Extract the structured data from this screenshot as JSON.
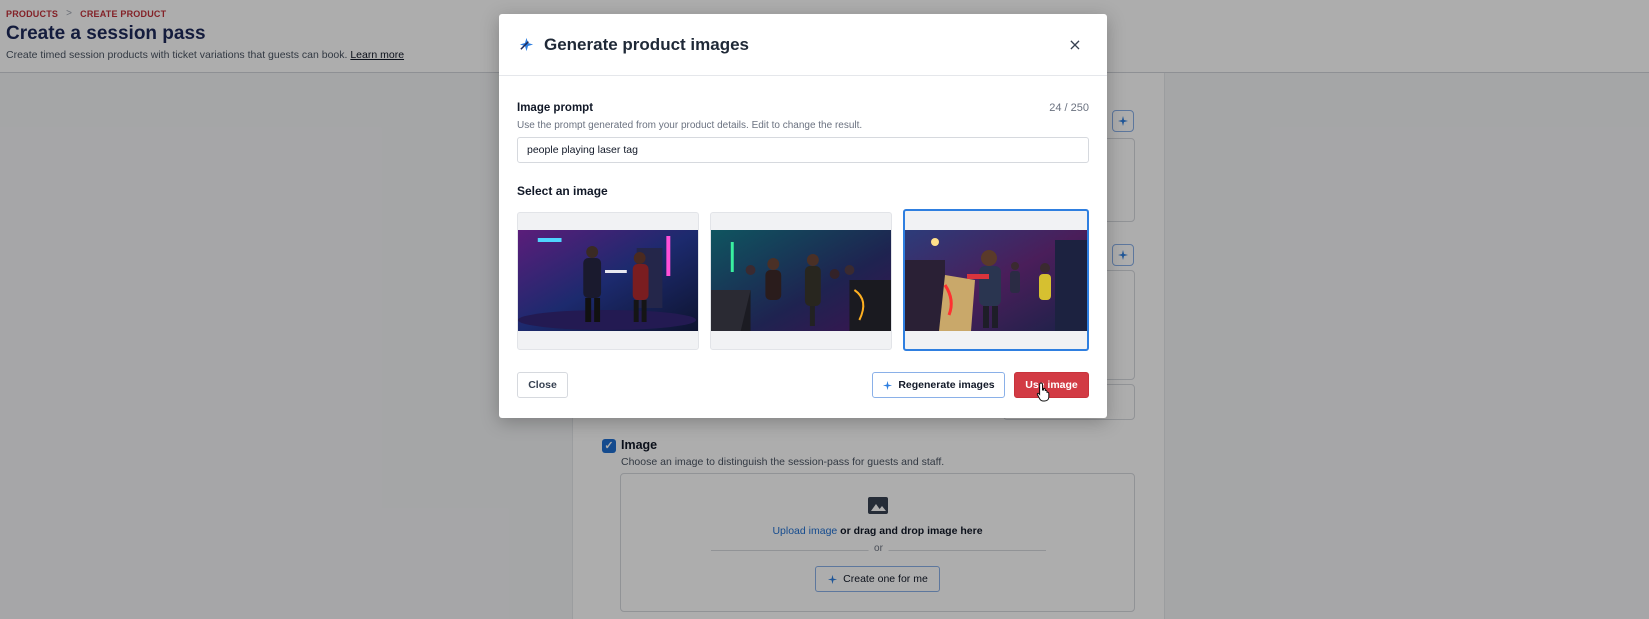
{
  "header": {
    "breadcrumb": [
      "PRODUCTS",
      "CREATE PRODUCT"
    ],
    "breadcrumb_separator": ">",
    "title": "Create a session pass",
    "subtitle": "Create timed session products with ticket variations that guests can book.",
    "learn_more": "Learn more"
  },
  "background_form": {
    "image_checkbox_checked": true,
    "image_label": "Image",
    "image_help": "Choose an image to distinguish the session-pass for guests and staff.",
    "upload_link": "Upload image",
    "upload_rest": " or drag and drop image here",
    "or_text": "or",
    "create_button": "Create one for me"
  },
  "modal": {
    "icon": "sparkle-ai-icon",
    "title": "Generate product images",
    "close_icon": "×",
    "prompt_label": "Image prompt",
    "prompt_count": "24 / 250",
    "prompt_help": "Use the prompt generated from your product details. Edit to change the result.",
    "prompt_value": "people playing laser tag",
    "select_label": "Select an image",
    "selected_index": 2,
    "close_button": "Close",
    "regenerate_button": "Regenerate images",
    "use_button": "Use image"
  },
  "colors": {
    "accent_red": "#d23b44",
    "accent_blue": "#2f7fe0",
    "title_navy": "#1e2a5a"
  }
}
